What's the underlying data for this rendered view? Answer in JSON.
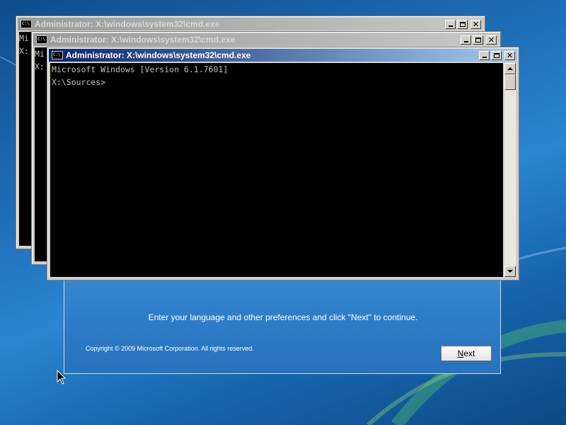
{
  "setup": {
    "message": "Enter your language and other preferences and click \"Next\" to continue.",
    "copyright": "Copyright © 2009 Microsoft Corporation. All rights reserved.",
    "next_button_underlined": "N",
    "next_button_rest": "ext"
  },
  "consoles": [
    {
      "title": "Administrator: X:\\windows\\system32\\cmd.exe",
      "icon_label": "C:\\",
      "line1": "Mi",
      "line2": "",
      "line3": "X:"
    },
    {
      "title": "Administrator: X:\\windows\\system32\\cmd.exe",
      "icon_label": "C:\\",
      "line1": "Mi",
      "line2": "",
      "line3": "X:"
    },
    {
      "title": "Administrator: X:\\windows\\system32\\cmd.exe",
      "icon_label": "C:\\",
      "line1": "Microsoft Windows [Version 6.1.7601]",
      "line2": "",
      "line3": "X:\\Sources>"
    }
  ],
  "colors": {
    "desktop": "#1f6fb8",
    "active_title": "#0a246a",
    "inactive_title": "#9a9a9a",
    "console_bg": "#000000",
    "console_text": "#c0c0c0"
  }
}
